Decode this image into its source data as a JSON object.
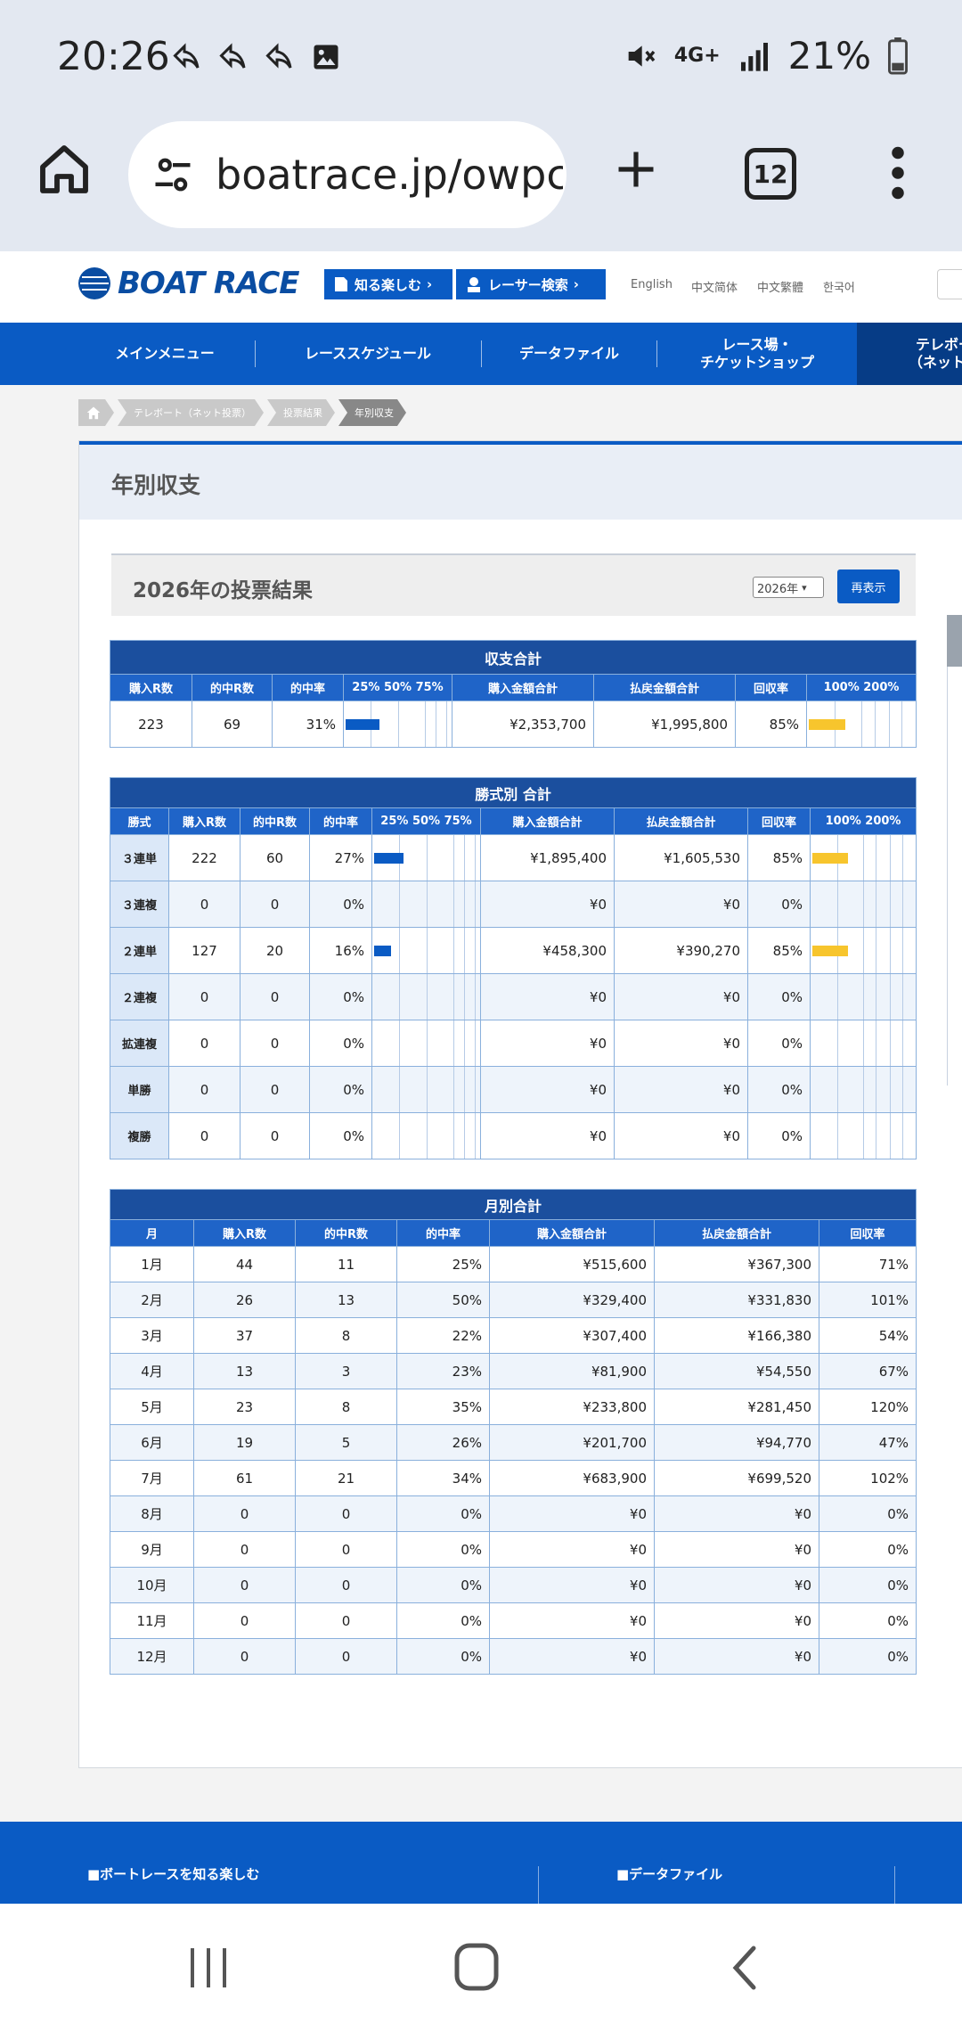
{
  "status_bar": {
    "time": "20:26",
    "network": "4G+",
    "battery": "21%"
  },
  "browser": {
    "url": "boatrace.jp/owpc",
    "tab_count": "12"
  },
  "site": {
    "logo": "BOAT RACE",
    "header_buttons": [
      "知る楽しむ",
      "レーサー検索"
    ],
    "languages": [
      "English",
      "中文简体",
      "中文繁體",
      "한국어"
    ],
    "nav": [
      "メインメニュー",
      "レーススケジュール",
      "データファイル",
      "レース場・\nチケットショップ",
      "テレボー\n（ネット投"
    ],
    "breadcrumb": [
      "テレボート（ネット投票）",
      "投票結果",
      "年別収支"
    ]
  },
  "page": {
    "title": "年別収支",
    "year_title": "2026年の投票結果",
    "year_select": "2026年",
    "redisplay_label": "再表示"
  },
  "summary": {
    "caption": "収支合計",
    "headers": [
      "購入R数",
      "的中R数",
      "的中率",
      "25% 50% 75%",
      "購入金額合計",
      "払戻金額合計",
      "回収率",
      "100% 200%"
    ],
    "row": {
      "bought": "223",
      "hits": "69",
      "hit_rate": "31%",
      "hit_rate_value": 31,
      "purchase": "¥2,353,700",
      "payout": "¥1,995,800",
      "return_rate": "85%",
      "return_rate_value": 85
    }
  },
  "by_type": {
    "caption": "勝式別 合計",
    "headers": [
      "勝式",
      "購入R数",
      "的中R数",
      "的中率",
      "25% 50% 75%",
      "購入金額合計",
      "払戻金額合計",
      "回収率",
      "100% 200%"
    ],
    "rows": [
      {
        "type": "３連単",
        "bought": "222",
        "hits": "60",
        "hit_rate": "27%",
        "hit_rate_value": 27,
        "purchase": "¥1,895,400",
        "payout": "¥1,605,530",
        "return_rate": "85%",
        "return_rate_value": 85
      },
      {
        "type": "３連複",
        "bought": "0",
        "hits": "0",
        "hit_rate": "0%",
        "hit_rate_value": 0,
        "purchase": "¥0",
        "payout": "¥0",
        "return_rate": "0%",
        "return_rate_value": 0
      },
      {
        "type": "２連単",
        "bought": "127",
        "hits": "20",
        "hit_rate": "16%",
        "hit_rate_value": 16,
        "purchase": "¥458,300",
        "payout": "¥390,270",
        "return_rate": "85%",
        "return_rate_value": 85
      },
      {
        "type": "２連複",
        "bought": "0",
        "hits": "0",
        "hit_rate": "0%",
        "hit_rate_value": 0,
        "purchase": "¥0",
        "payout": "¥0",
        "return_rate": "0%",
        "return_rate_value": 0
      },
      {
        "type": "拡連複",
        "bought": "0",
        "hits": "0",
        "hit_rate": "0%",
        "hit_rate_value": 0,
        "purchase": "¥0",
        "payout": "¥0",
        "return_rate": "0%",
        "return_rate_value": 0
      },
      {
        "type": "単勝",
        "bought": "0",
        "hits": "0",
        "hit_rate": "0%",
        "hit_rate_value": 0,
        "purchase": "¥0",
        "payout": "¥0",
        "return_rate": "0%",
        "return_rate_value": 0
      },
      {
        "type": "複勝",
        "bought": "0",
        "hits": "0",
        "hit_rate": "0%",
        "hit_rate_value": 0,
        "purchase": "¥0",
        "payout": "¥0",
        "return_rate": "0%",
        "return_rate_value": 0
      }
    ]
  },
  "monthly": {
    "caption": "月別合計",
    "headers": [
      "月",
      "購入R数",
      "的中R数",
      "的中率",
      "購入金額合計",
      "払戻金額合計",
      "回収率"
    ],
    "rows": [
      {
        "month": "1月",
        "bought": "44",
        "hits": "11",
        "hit_rate": "25%",
        "purchase": "¥515,600",
        "payout": "¥367,300",
        "return_rate": "71%"
      },
      {
        "month": "2月",
        "bought": "26",
        "hits": "13",
        "hit_rate": "50%",
        "purchase": "¥329,400",
        "payout": "¥331,830",
        "return_rate": "101%"
      },
      {
        "month": "3月",
        "bought": "37",
        "hits": "8",
        "hit_rate": "22%",
        "purchase": "¥307,400",
        "payout": "¥166,380",
        "return_rate": "54%"
      },
      {
        "month": "4月",
        "bought": "13",
        "hits": "3",
        "hit_rate": "23%",
        "purchase": "¥81,900",
        "payout": "¥54,550",
        "return_rate": "67%"
      },
      {
        "month": "5月",
        "bought": "23",
        "hits": "8",
        "hit_rate": "35%",
        "purchase": "¥233,800",
        "payout": "¥281,450",
        "return_rate": "120%"
      },
      {
        "month": "6月",
        "bought": "19",
        "hits": "5",
        "hit_rate": "26%",
        "purchase": "¥201,700",
        "payout": "¥94,770",
        "return_rate": "47%"
      },
      {
        "month": "7月",
        "bought": "61",
        "hits": "21",
        "hit_rate": "34%",
        "purchase": "¥683,900",
        "payout": "¥699,520",
        "return_rate": "102%"
      },
      {
        "month": "8月",
        "bought": "0",
        "hits": "0",
        "hit_rate": "0%",
        "purchase": "¥0",
        "payout": "¥0",
        "return_rate": "0%"
      },
      {
        "month": "9月",
        "bought": "0",
        "hits": "0",
        "hit_rate": "0%",
        "purchase": "¥0",
        "payout": "¥0",
        "return_rate": "0%"
      },
      {
        "month": "10月",
        "bought": "0",
        "hits": "0",
        "hit_rate": "0%",
        "purchase": "¥0",
        "payout": "¥0",
        "return_rate": "0%"
      },
      {
        "month": "11月",
        "bought": "0",
        "hits": "0",
        "hit_rate": "0%",
        "purchase": "¥0",
        "payout": "¥0",
        "return_rate": "0%"
      },
      {
        "month": "12月",
        "bought": "0",
        "hits": "0",
        "hit_rate": "0%",
        "purchase": "¥0",
        "payout": "¥0",
        "return_rate": "0%"
      }
    ]
  },
  "footer": {
    "items": [
      "■ボートレースを知る楽しむ",
      "■データファイル"
    ]
  },
  "colors": {
    "brand_blue": "#0a5bc4",
    "caption_blue": "#1b4f9e",
    "hit_bar": "#0a5bc4",
    "return_bar": "#f7c52d"
  },
  "icons": [
    "home-icon",
    "tune-icon",
    "plus-icon",
    "more-vert-icon",
    "recent-apps-icon",
    "nav-home-icon",
    "back-icon",
    "mute-icon",
    "signal-icon",
    "battery-icon",
    "reply-icon",
    "image-icon",
    "search-icon"
  ]
}
